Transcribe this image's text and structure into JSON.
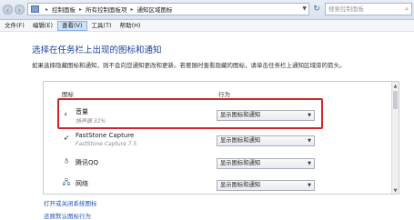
{
  "address": {
    "crumbs": [
      "控制面板",
      "所有控制面板项",
      "通知区域图标"
    ],
    "search_placeholder": "搜索控制面板"
  },
  "menu": [
    "文件(F)",
    "编辑(E)",
    "查看(V)",
    "工具(T)",
    "帮助(H)"
  ],
  "page": {
    "title": "选择在任务栏上出现的图标和通知",
    "desc": "如果选择隐藏图标和通知，则不会向您通知更改和更新。若要随时查看隐藏的图标，请单击任务栏上通知区域旁的箭头。"
  },
  "table": {
    "col_icon": "图标",
    "col_behavior": "行为",
    "rows": [
      {
        "name": "音量",
        "sub": "扬声器 32%",
        "behavior": "显示图标和通知"
      },
      {
        "name": "FastStone Capture",
        "sub": "FastStone Capture 7.5",
        "behavior": "显示图标和通知"
      },
      {
        "name": "腾讯QQ",
        "sub": "",
        "behavior": "显示图标和通知"
      },
      {
        "name": "网络",
        "sub": "",
        "behavior": "显示图标和通知"
      }
    ]
  },
  "links": {
    "toggle_system_icons": "打开或关闭系统图标",
    "restore_defaults": "还原默认图标行为"
  },
  "colors": {
    "title_blue": "#1e3f99",
    "link_blue": "#1f54b8",
    "highlight_red": "#d02626"
  }
}
